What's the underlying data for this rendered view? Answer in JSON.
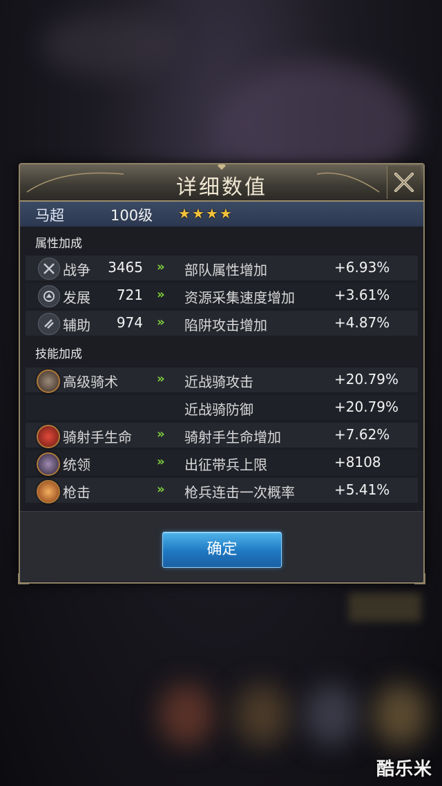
{
  "dialog": {
    "title": "详细数值",
    "confirm_label": "确定"
  },
  "hero": {
    "name": "马超",
    "level": "100级",
    "stars": [
      "★",
      "★",
      "★",
      "★"
    ]
  },
  "sections": {
    "attribute_title": "属性加成",
    "skill_title": "技能加成"
  },
  "attributes": [
    {
      "name": "战争",
      "value": "3465",
      "effect": "部队属性增加",
      "bonus": "+6.93%",
      "icon": "crossed-swords-icon"
    },
    {
      "name": "发展",
      "value": "721",
      "effect": "资源采集速度增加",
      "bonus": "+3.61%",
      "icon": "development-icon"
    },
    {
      "name": "辅助",
      "value": "974",
      "effect": "陷阱攻击增加",
      "bonus": "+4.87%",
      "icon": "support-icon"
    }
  ],
  "skills": [
    {
      "name": "高级骑术",
      "effects": [
        {
          "text": "近战骑攻击",
          "bonus": "+20.79%"
        },
        {
          "text": "近战骑防御",
          "bonus": "+20.79%"
        }
      ],
      "icon": "cavalry-skill-icon",
      "color": "#6b4a3a"
    },
    {
      "name": "骑射手生命",
      "effects": [
        {
          "text": "骑射手生命增加",
          "bonus": "+7.62%"
        }
      ],
      "icon": "horse-archer-skill-icon",
      "color": "#b8342a"
    },
    {
      "name": "统领",
      "effects": [
        {
          "text": "出征带兵上限",
          "bonus": "+8108"
        }
      ],
      "icon": "command-skill-icon",
      "color": "#5a4a70"
    },
    {
      "name": "枪击",
      "effects": [
        {
          "text": "枪兵连击一次概率",
          "bonus": "+5.41%"
        }
      ],
      "icon": "spear-strike-skill-icon",
      "color": "#c2692a"
    }
  ],
  "arrow_glyph": "»",
  "watermark": "酷乐米",
  "colors": {
    "accent_gold": "#8f8266",
    "arrow_green": "#7fd13a",
    "button_blue": "#1f78c2",
    "star_gold": "#f3c13a"
  }
}
